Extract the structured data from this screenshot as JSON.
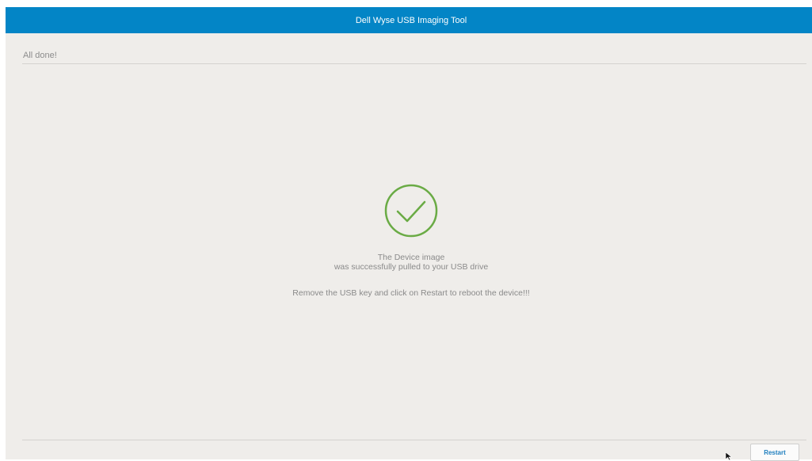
{
  "window": {
    "title": "Dell Wyse USB Imaging Tool"
  },
  "status": {
    "heading": "All done!"
  },
  "message": {
    "line1": "The Device image",
    "line2": "was successfully pulled to your USB drive",
    "instruction": "Remove the USB key and click on Restart to reboot the device!!!"
  },
  "footer": {
    "restart_label": "Restart"
  },
  "icons": {
    "success": "check-circle-icon"
  },
  "colors": {
    "titlebar": "#0385c6",
    "success": "#6aab45",
    "background": "#efedea",
    "button_text": "#1f7fbf"
  }
}
